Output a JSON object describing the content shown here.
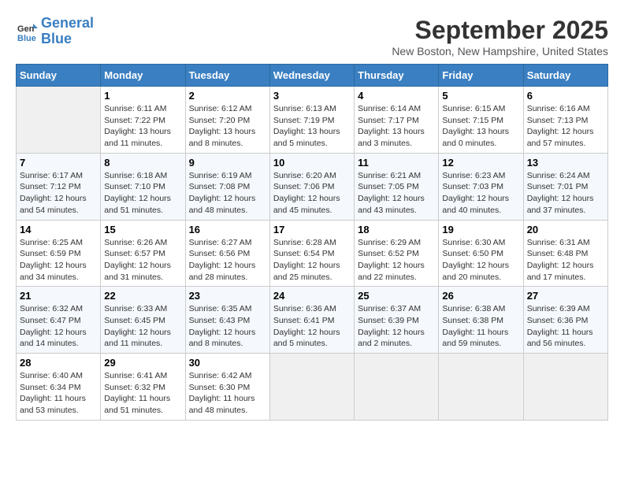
{
  "header": {
    "logo_line1": "General",
    "logo_line2": "Blue",
    "month_title": "September 2025",
    "subtitle": "New Boston, New Hampshire, United States"
  },
  "days_of_week": [
    "Sunday",
    "Monday",
    "Tuesday",
    "Wednesday",
    "Thursday",
    "Friday",
    "Saturday"
  ],
  "weeks": [
    [
      {
        "day": "",
        "empty": true
      },
      {
        "day": "1",
        "sunrise": "Sunrise: 6:11 AM",
        "sunset": "Sunset: 7:22 PM",
        "daylight": "Daylight: 13 hours and 11 minutes."
      },
      {
        "day": "2",
        "sunrise": "Sunrise: 6:12 AM",
        "sunset": "Sunset: 7:20 PM",
        "daylight": "Daylight: 13 hours and 8 minutes."
      },
      {
        "day": "3",
        "sunrise": "Sunrise: 6:13 AM",
        "sunset": "Sunset: 7:19 PM",
        "daylight": "Daylight: 13 hours and 5 minutes."
      },
      {
        "day": "4",
        "sunrise": "Sunrise: 6:14 AM",
        "sunset": "Sunset: 7:17 PM",
        "daylight": "Daylight: 13 hours and 3 minutes."
      },
      {
        "day": "5",
        "sunrise": "Sunrise: 6:15 AM",
        "sunset": "Sunset: 7:15 PM",
        "daylight": "Daylight: 13 hours and 0 minutes."
      },
      {
        "day": "6",
        "sunrise": "Sunrise: 6:16 AM",
        "sunset": "Sunset: 7:13 PM",
        "daylight": "Daylight: 12 hours and 57 minutes."
      }
    ],
    [
      {
        "day": "7",
        "sunrise": "Sunrise: 6:17 AM",
        "sunset": "Sunset: 7:12 PM",
        "daylight": "Daylight: 12 hours and 54 minutes."
      },
      {
        "day": "8",
        "sunrise": "Sunrise: 6:18 AM",
        "sunset": "Sunset: 7:10 PM",
        "daylight": "Daylight: 12 hours and 51 minutes."
      },
      {
        "day": "9",
        "sunrise": "Sunrise: 6:19 AM",
        "sunset": "Sunset: 7:08 PM",
        "daylight": "Daylight: 12 hours and 48 minutes."
      },
      {
        "day": "10",
        "sunrise": "Sunrise: 6:20 AM",
        "sunset": "Sunset: 7:06 PM",
        "daylight": "Daylight: 12 hours and 45 minutes."
      },
      {
        "day": "11",
        "sunrise": "Sunrise: 6:21 AM",
        "sunset": "Sunset: 7:05 PM",
        "daylight": "Daylight: 12 hours and 43 minutes."
      },
      {
        "day": "12",
        "sunrise": "Sunrise: 6:23 AM",
        "sunset": "Sunset: 7:03 PM",
        "daylight": "Daylight: 12 hours and 40 minutes."
      },
      {
        "day": "13",
        "sunrise": "Sunrise: 6:24 AM",
        "sunset": "Sunset: 7:01 PM",
        "daylight": "Daylight: 12 hours and 37 minutes."
      }
    ],
    [
      {
        "day": "14",
        "sunrise": "Sunrise: 6:25 AM",
        "sunset": "Sunset: 6:59 PM",
        "daylight": "Daylight: 12 hours and 34 minutes."
      },
      {
        "day": "15",
        "sunrise": "Sunrise: 6:26 AM",
        "sunset": "Sunset: 6:57 PM",
        "daylight": "Daylight: 12 hours and 31 minutes."
      },
      {
        "day": "16",
        "sunrise": "Sunrise: 6:27 AM",
        "sunset": "Sunset: 6:56 PM",
        "daylight": "Daylight: 12 hours and 28 minutes."
      },
      {
        "day": "17",
        "sunrise": "Sunrise: 6:28 AM",
        "sunset": "Sunset: 6:54 PM",
        "daylight": "Daylight: 12 hours and 25 minutes."
      },
      {
        "day": "18",
        "sunrise": "Sunrise: 6:29 AM",
        "sunset": "Sunset: 6:52 PM",
        "daylight": "Daylight: 12 hours and 22 minutes."
      },
      {
        "day": "19",
        "sunrise": "Sunrise: 6:30 AM",
        "sunset": "Sunset: 6:50 PM",
        "daylight": "Daylight: 12 hours and 20 minutes."
      },
      {
        "day": "20",
        "sunrise": "Sunrise: 6:31 AM",
        "sunset": "Sunset: 6:48 PM",
        "daylight": "Daylight: 12 hours and 17 minutes."
      }
    ],
    [
      {
        "day": "21",
        "sunrise": "Sunrise: 6:32 AM",
        "sunset": "Sunset: 6:47 PM",
        "daylight": "Daylight: 12 hours and 14 minutes."
      },
      {
        "day": "22",
        "sunrise": "Sunrise: 6:33 AM",
        "sunset": "Sunset: 6:45 PM",
        "daylight": "Daylight: 12 hours and 11 minutes."
      },
      {
        "day": "23",
        "sunrise": "Sunrise: 6:35 AM",
        "sunset": "Sunset: 6:43 PM",
        "daylight": "Daylight: 12 hours and 8 minutes."
      },
      {
        "day": "24",
        "sunrise": "Sunrise: 6:36 AM",
        "sunset": "Sunset: 6:41 PM",
        "daylight": "Daylight: 12 hours and 5 minutes."
      },
      {
        "day": "25",
        "sunrise": "Sunrise: 6:37 AM",
        "sunset": "Sunset: 6:39 PM",
        "daylight": "Daylight: 12 hours and 2 minutes."
      },
      {
        "day": "26",
        "sunrise": "Sunrise: 6:38 AM",
        "sunset": "Sunset: 6:38 PM",
        "daylight": "Daylight: 11 hours and 59 minutes."
      },
      {
        "day": "27",
        "sunrise": "Sunrise: 6:39 AM",
        "sunset": "Sunset: 6:36 PM",
        "daylight": "Daylight: 11 hours and 56 minutes."
      }
    ],
    [
      {
        "day": "28",
        "sunrise": "Sunrise: 6:40 AM",
        "sunset": "Sunset: 6:34 PM",
        "daylight": "Daylight: 11 hours and 53 minutes."
      },
      {
        "day": "29",
        "sunrise": "Sunrise: 6:41 AM",
        "sunset": "Sunset: 6:32 PM",
        "daylight": "Daylight: 11 hours and 51 minutes."
      },
      {
        "day": "30",
        "sunrise": "Sunrise: 6:42 AM",
        "sunset": "Sunset: 6:30 PM",
        "daylight": "Daylight: 11 hours and 48 minutes."
      },
      {
        "day": "",
        "empty": true
      },
      {
        "day": "",
        "empty": true
      },
      {
        "day": "",
        "empty": true
      },
      {
        "day": "",
        "empty": true
      }
    ]
  ]
}
